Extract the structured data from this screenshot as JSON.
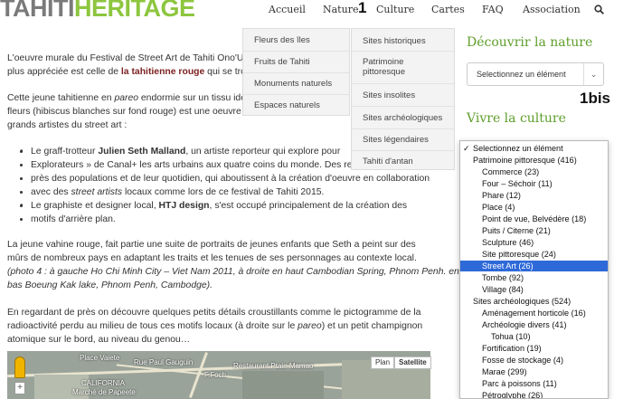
{
  "header": {
    "logo_part1": "TAHITI",
    "logo_part2": "HERITAGE",
    "nav": [
      "Accueil",
      "Nature",
      "Culture",
      "Cartes",
      "FAQ",
      "Association"
    ],
    "search_icon": "search-icon",
    "marker_1": "1",
    "marker_1bis": "1bis"
  },
  "menus": {
    "nature": [
      "Fleurs des îles",
      "Fruits de Tahiti",
      "Monuments naturels",
      "Espaces naturels"
    ],
    "culture": [
      "Sites historiques",
      "Patrimoine",
      "pittoresque",
      "Sites insolites",
      "Sites archéologiques",
      "Sites légendaires",
      "Tahiti d'antan"
    ]
  },
  "article": {
    "p1_l1": "L'oeuvre murale du Festival de Street Art de Tahiti Ono'U",
    "p1_l2a": "plus appréciée est celle de ",
    "p1_l2b": "la tahitienne rouge",
    "p1_l2c": " qui se trou",
    "p2_l1a": "Cette jeune tahitienne en ",
    "p2_l1b": "pareo",
    "p2_l1c": " endormie sur un tissu ide",
    "p2_l2": "fleurs (hibiscus blanches sur fond rouge) est une oeuvre i",
    "p2_l3": "grands artistes du street art :",
    "li1_l1a": "Le graff-trotteur ",
    "li1_l1b": "Julien Seth Malland",
    "li1_l1c": ", un artiste reporteur qui explore pour",
    "li1_l2": "Explorateurs » de Canal+ les arts urbains aux quatre coins du monde. Des re",
    "li1_l3": "près des populations et de leur quotidien, qui aboutissent à la création d'oeuvre en  collaboration",
    "li1_l4a": "avec des ",
    "li1_l4b": "street artists",
    "li1_l4c": " locaux comme lors de ce festival de Tahiti 2015.",
    "li2_l1a": "Le graphiste et designer local, ",
    "li2_l1b": "HTJ design",
    "li2_l1c": ", s'est occupé principalement de la création des",
    "li2_l2": "motifs d'arrière plan.",
    "p3_l1": "La jeune vahine rouge, fait partie une suite de portraits de jeunes enfants que Seth a peint sur des",
    "p3_l2": "mûrs de nombreux pays en adaptant les traits et les tenues de ses personnages au contexte local.",
    "p3_l3": "(photo 4 : à gauche Ho Chi Minh City – Viet Nam 2011, à droite en haut Cambodian Spring, Phnom Penh. en",
    "p3_l4": "bas Boeung Kak lake, Phnom Penh, Cambodge).",
    "p4_l1": "En regardant de près on découvre quelques petits détails croustillants comme le pictogramme de la",
    "p4_l2a": "radioactivité perdu au milieu de tous ces motifs locaux (à droite sur le ",
    "p4_l2b": "pareo",
    "p4_l2c": ") et un petit champignon",
    "p4_l3": "atomique sur le bord, au niveau du genou…"
  },
  "map": {
    "labels": [
      "Rue Paul Gauguin",
      "Restaurant Ptaie Mamao",
      "Place Vaiete",
      "CALIFORNIA",
      "Marché de Papeete",
      "F.Foch"
    ],
    "plan": "Plan",
    "satellite": "Satellite",
    "zoom_plus": "+"
  },
  "sidebar": {
    "heading1": "Découvrir la nature",
    "select_placeholder": "Selectionnez un élément",
    "heading2": "Vivre la culture",
    "options": [
      {
        "label": "Selectionnez un élément",
        "indent": 0,
        "checked": true,
        "selected": false
      },
      {
        "label": "Patrimoine pittoresque   (416)",
        "indent": 1,
        "checked": false,
        "selected": false
      },
      {
        "label": "Commerce   (23)",
        "indent": 2,
        "checked": false,
        "selected": false
      },
      {
        "label": "Four – Séchoir   (11)",
        "indent": 2,
        "checked": false,
        "selected": false
      },
      {
        "label": "Phare   (12)",
        "indent": 2,
        "checked": false,
        "selected": false
      },
      {
        "label": "Place   (4)",
        "indent": 2,
        "checked": false,
        "selected": false
      },
      {
        "label": "Point de vue, Belvédère   (18)",
        "indent": 2,
        "checked": false,
        "selected": false
      },
      {
        "label": "Puits / Citerne   (21)",
        "indent": 2,
        "checked": false,
        "selected": false
      },
      {
        "label": "Sculpture   (46)",
        "indent": 2,
        "checked": false,
        "selected": false
      },
      {
        "label": "Site pittoresque   (24)",
        "indent": 2,
        "checked": false,
        "selected": false
      },
      {
        "label": "Street Art   (26)",
        "indent": 2,
        "checked": false,
        "selected": true
      },
      {
        "label": "Tombe   (92)",
        "indent": 2,
        "checked": false,
        "selected": false
      },
      {
        "label": "Village   (84)",
        "indent": 2,
        "checked": false,
        "selected": false
      },
      {
        "label": "Sites archéologiques   (524)",
        "indent": 1,
        "checked": false,
        "selected": false
      },
      {
        "label": "Aménagement horticole   (16)",
        "indent": 2,
        "checked": false,
        "selected": false
      },
      {
        "label": "Archéologie divers   (41)",
        "indent": 2,
        "checked": false,
        "selected": false
      },
      {
        "label": "Tohua   (10)",
        "indent": 3,
        "checked": false,
        "selected": false
      },
      {
        "label": "Fortification   (19)",
        "indent": 2,
        "checked": false,
        "selected": false
      },
      {
        "label": "Fosse de stockage   (4)",
        "indent": 2,
        "checked": false,
        "selected": false
      },
      {
        "label": "Marae   (299)",
        "indent": 2,
        "checked": false,
        "selected": false
      },
      {
        "label": "Parc à poissons   (11)",
        "indent": 2,
        "checked": false,
        "selected": false
      },
      {
        "label": "Pétroglyphe   (26)",
        "indent": 2,
        "checked": false,
        "selected": false
      }
    ]
  },
  "colors": {
    "brand_green": "#8dc63f",
    "heading_green": "#5e9e2a",
    "highlight": "#2e69d8",
    "accent_red": "#7b1f1f"
  }
}
